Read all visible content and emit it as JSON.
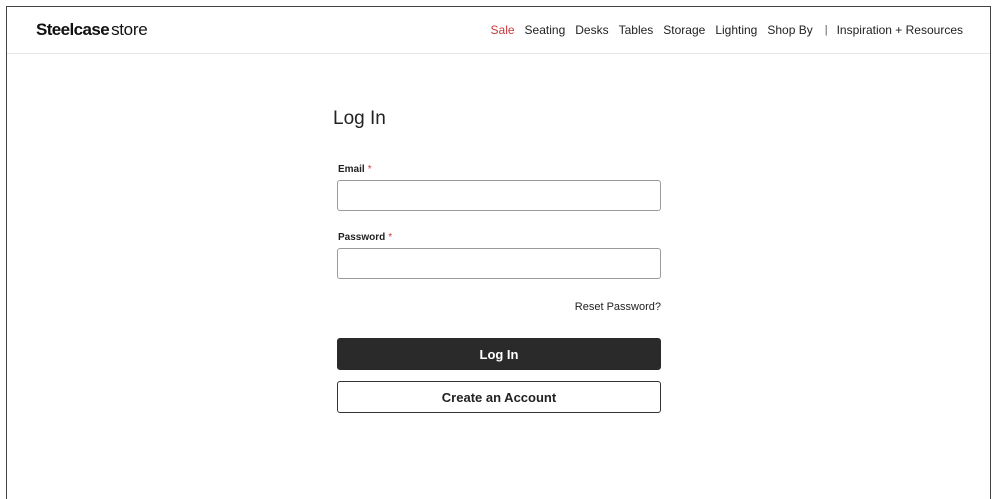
{
  "header": {
    "logo_brand": "Steelcase",
    "logo_suffix": "store",
    "nav": {
      "sale": "Sale",
      "seating": "Seating",
      "desks": "Desks",
      "tables": "Tables",
      "storage": "Storage",
      "lighting": "Lighting",
      "shop_by": "Shop By",
      "separator": "|",
      "inspiration": "Inspiration + Resources"
    }
  },
  "login": {
    "title": "Log In",
    "email_label": "Email",
    "password_label": "Password",
    "required_marker": "*",
    "email_value": "",
    "password_value": "",
    "reset_password": "Reset Password?",
    "login_button": "Log In",
    "create_account_button": "Create an Account"
  },
  "colors": {
    "accent": "#c73a3a",
    "primary_button": "#2a2a2a"
  }
}
